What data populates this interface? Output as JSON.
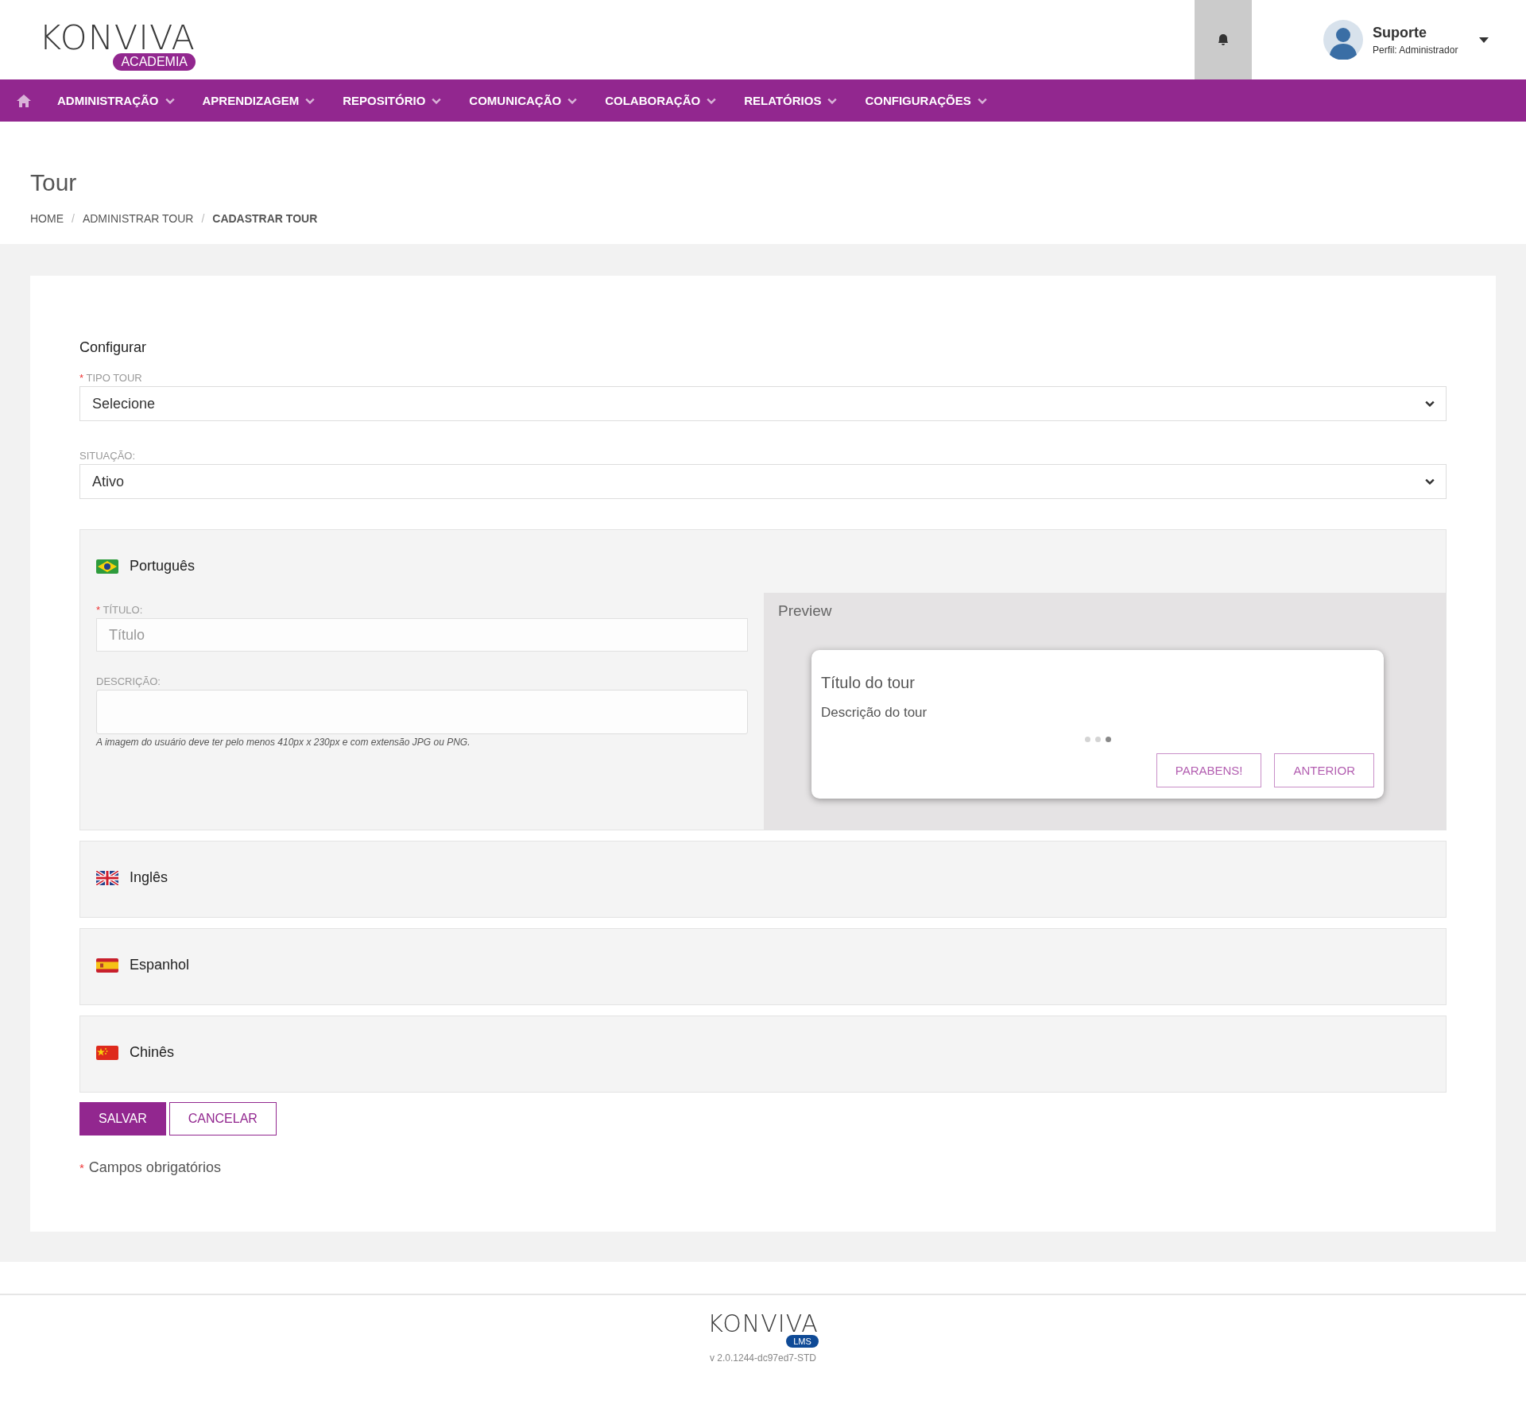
{
  "header": {
    "logo": {
      "name": "KONVIVA",
      "badge": "ACADEMIA"
    },
    "user": {
      "name": "Suporte",
      "profile": "Perfil: Administrador"
    }
  },
  "nav": [
    {
      "label": "ADMINISTRAÇÃO"
    },
    {
      "label": "APRENDIZAGEM"
    },
    {
      "label": "REPOSITÓRIO"
    },
    {
      "label": "COMUNICAÇÃO"
    },
    {
      "label": "COLABORAÇÃO"
    },
    {
      "label": "RELATÓRIOS"
    },
    {
      "label": "CONFIGURAÇÕES"
    }
  ],
  "page": {
    "title": "Tour",
    "separator": "/",
    "breadcrumbs": [
      {
        "label": "HOME",
        "current": false
      },
      {
        "label": "ADMINISTRAR TOUR",
        "current": false
      },
      {
        "label": "CADASTRAR TOUR",
        "current": true
      }
    ]
  },
  "form": {
    "section_title": "Configurar",
    "fields": [
      {
        "label": "TIPO TOUR",
        "required": true,
        "value": "Selecione"
      },
      {
        "label": "SITUAÇÃO:",
        "required": false,
        "value": "Ativo"
      }
    ]
  },
  "languages": [
    {
      "name": "Português",
      "kind": "brazil",
      "expanded": true,
      "title_field": {
        "label": "TÍTULO:",
        "required": true,
        "placeholder": "Título"
      },
      "description_field": {
        "label": "DESCRIÇÃO:",
        "hint": "A imagem do usuário deve ter pelo menos 410px x 230px e com extensão JPG ou PNG."
      },
      "preview": {
        "heading": "Preview",
        "card_title": "Título do tour",
        "card_text": "Descrição do tour",
        "steps": [
          {
            "selected": false
          },
          {
            "selected": false
          },
          {
            "selected": true
          }
        ],
        "buttons": [
          "PARABENS!",
          "ANTERIOR"
        ]
      }
    },
    {
      "name": "Inglês",
      "kind": "uk",
      "expanded": false
    },
    {
      "name": "Espanhol",
      "kind": "spain",
      "expanded": false
    },
    {
      "name": "Chinês",
      "kind": "china",
      "expanded": false
    }
  ],
  "actions": [
    {
      "label": "SALVAR",
      "kind": "primary"
    },
    {
      "label": "CANCELAR",
      "kind": "secondary"
    }
  ],
  "required_mark": "*",
  "required_note": "Campos obrigatórios",
  "footer": {
    "logo": {
      "name": "KONVIVA",
      "badge": "LMS"
    },
    "version": "v 2.0.1244-dc97ed7-STD"
  }
}
